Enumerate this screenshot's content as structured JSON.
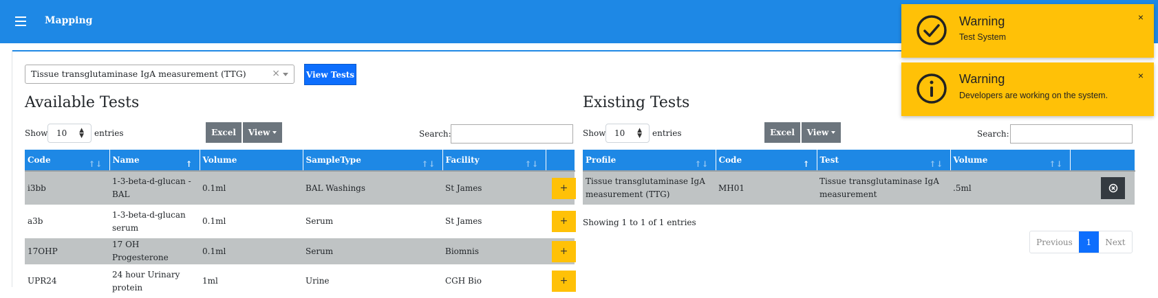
{
  "header": {
    "title": "Mapping"
  },
  "selector": {
    "value": "Tissue transglutaminase IgA measurement (TTG)",
    "clear_symbol": "×"
  },
  "view_tests_label": "View Tests",
  "available": {
    "title": "Available Tests",
    "show_label": "Show",
    "entries_label": "entries",
    "length_value": "10",
    "excel_label": "Excel",
    "view_label": "View",
    "search_label": "Search:",
    "columns": [
      "Code",
      "Name",
      "Volume",
      "SampleType",
      "Facility"
    ],
    "rows": [
      {
        "code": "i3bb",
        "name": "1-3-beta-d-glucan - BAL",
        "volume": "0.1ml",
        "sample": "BAL Washings",
        "facility": "St James"
      },
      {
        "code": "a3b",
        "name": "1-3-beta-d-glucan serum",
        "volume": "0.1ml",
        "sample": "Serum",
        "facility": "St James"
      },
      {
        "code": "17OHP",
        "name": "17 OH Progesterone",
        "volume": "0.1ml",
        "sample": "Serum",
        "facility": "Biomnis"
      },
      {
        "code": "UPR24",
        "name": "24 hour Urinary protein",
        "volume": "1ml",
        "sample": "Urine",
        "facility": "CGH Bio"
      }
    ],
    "add_symbol": "+"
  },
  "existing": {
    "title": "Existing Tests",
    "show_label": "Show",
    "entries_label": "entries",
    "length_value": "10",
    "excel_label": "Excel",
    "view_label": "View",
    "search_label": "Search:",
    "columns": [
      "Profile",
      "Code",
      "Test",
      "Volume"
    ],
    "rows": [
      {
        "profile": "Tissue transglutaminase IgA measurement (TTG)",
        "code": "MH01",
        "test": "Tissue transglutaminase IgA measurement",
        "volume": ".5ml"
      }
    ],
    "info": "Showing 1 to 1 of 1 entries",
    "pagination": {
      "previous": "Previous",
      "page": "1",
      "next": "Next"
    }
  },
  "toasts": [
    {
      "title": "Warning",
      "message": "Test System",
      "icon": "check-circle-icon"
    },
    {
      "title": "Warning",
      "message": "Developers are working on the system.",
      "icon": "info-circle-icon"
    }
  ],
  "colors": {
    "primary": "#1e88e5",
    "button_blue": "#0d6efd",
    "warning": "#ffc107",
    "gray_button": "#6c757d",
    "row_shade": "#bfc3c4",
    "dark_button": "#343a40"
  }
}
